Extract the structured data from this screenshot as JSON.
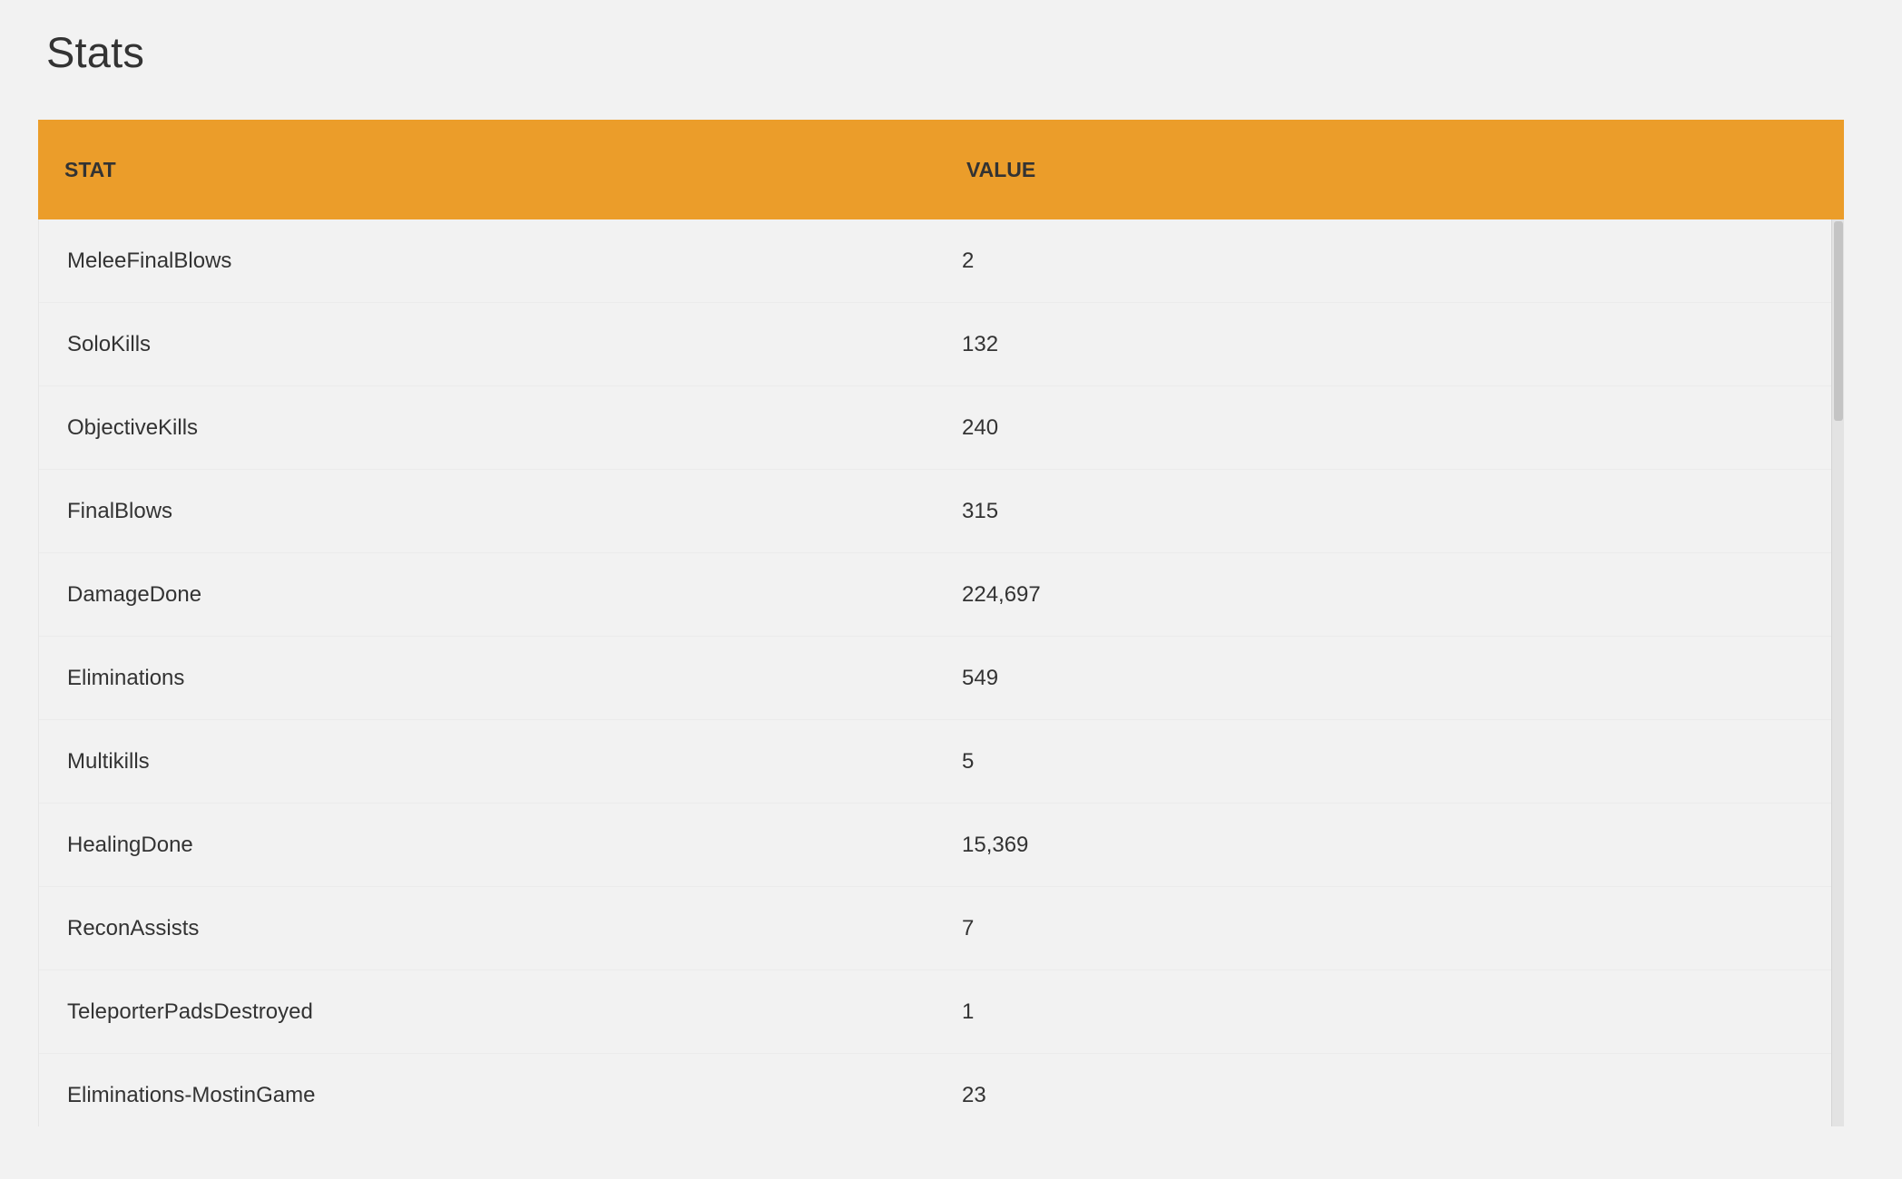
{
  "page": {
    "title": "Stats"
  },
  "table": {
    "headers": {
      "stat": "STAT",
      "value": "VALUE"
    },
    "header_color": "#eb9d2a",
    "rows": [
      {
        "stat": "MeleeFinalBlows",
        "value": "2"
      },
      {
        "stat": "SoloKills",
        "value": "132"
      },
      {
        "stat": "ObjectiveKills",
        "value": "240"
      },
      {
        "stat": "FinalBlows",
        "value": "315"
      },
      {
        "stat": "DamageDone",
        "value": "224,697"
      },
      {
        "stat": "Eliminations",
        "value": "549"
      },
      {
        "stat": "Multikills",
        "value": "5"
      },
      {
        "stat": "HealingDone",
        "value": "15,369"
      },
      {
        "stat": "ReconAssists",
        "value": "7"
      },
      {
        "stat": "TeleporterPadsDestroyed",
        "value": "1"
      },
      {
        "stat": "Eliminations-MostinGame",
        "value": "23"
      }
    ]
  }
}
